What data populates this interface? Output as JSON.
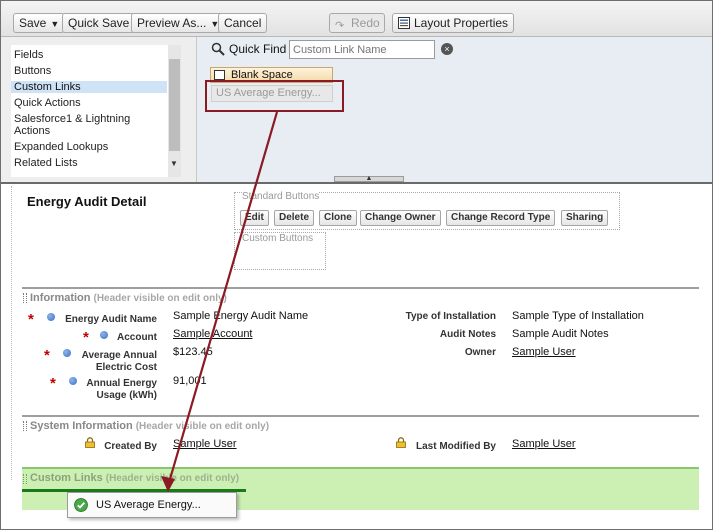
{
  "toolbar": {
    "save": "Save",
    "quick_save": "Quick Save",
    "preview_as": "Preview As...",
    "cancel": "Cancel",
    "redo": "Redo",
    "layout_properties": "Layout Properties"
  },
  "palette": {
    "categories": [
      {
        "label": "Fields"
      },
      {
        "label": "Buttons"
      },
      {
        "label": "Custom Links",
        "selected": true
      },
      {
        "label": "Quick Actions"
      },
      {
        "label": "Salesforce1 & Lightning Actions"
      },
      {
        "label": "Expanded Lookups"
      },
      {
        "label": "Related Lists"
      }
    ],
    "quick_find_label": "Quick Find",
    "quick_find_placeholder": "Custom Link Name",
    "items": {
      "blank_space": "Blank Space",
      "us_energy": "US Average Energy..."
    }
  },
  "main": {
    "detail_title": "Energy Audit Detail",
    "standard_buttons_label": "Standard Buttons",
    "standard_buttons": [
      "Edit",
      "Delete",
      "Clone",
      "Change Owner",
      "Change Record Type",
      "Sharing"
    ],
    "custom_buttons_label": "Custom Buttons",
    "information": {
      "title": "Information",
      "note": "(Header visible on edit only)",
      "left_fields": [
        {
          "label": "Energy Audit Name",
          "value": "Sample Energy Audit Name"
        },
        {
          "label": "Account",
          "value": "Sample Account"
        },
        {
          "label": "Average Annual Electric Cost",
          "value": "$123.45"
        },
        {
          "label": "Annual Energy Usage (kWh)",
          "value": "91,001"
        }
      ],
      "right_fields": [
        {
          "label": "Type of Installation",
          "value": "Sample Type of Installation"
        },
        {
          "label": "Audit Notes",
          "value": "Sample Audit Notes"
        },
        {
          "label": "Owner",
          "value": "Sample User"
        }
      ]
    },
    "system_information": {
      "title": "System Information",
      "note": "(Header visible on edit only)",
      "created_by_label": "Created By",
      "created_by_value": "Sample User",
      "last_modified_label": "Last Modified By",
      "last_modified_value": "Sample User"
    },
    "custom_links": {
      "title": "Custom Links",
      "note": "(Header visible on edit only)"
    },
    "dragged_item": "US Average Energy..."
  },
  "colors": {
    "highlight_red": "#8b1a24",
    "selected_category": "#cfe3f7",
    "drop_zone_green": "#ccf0b4",
    "required_red": "#c00000"
  }
}
